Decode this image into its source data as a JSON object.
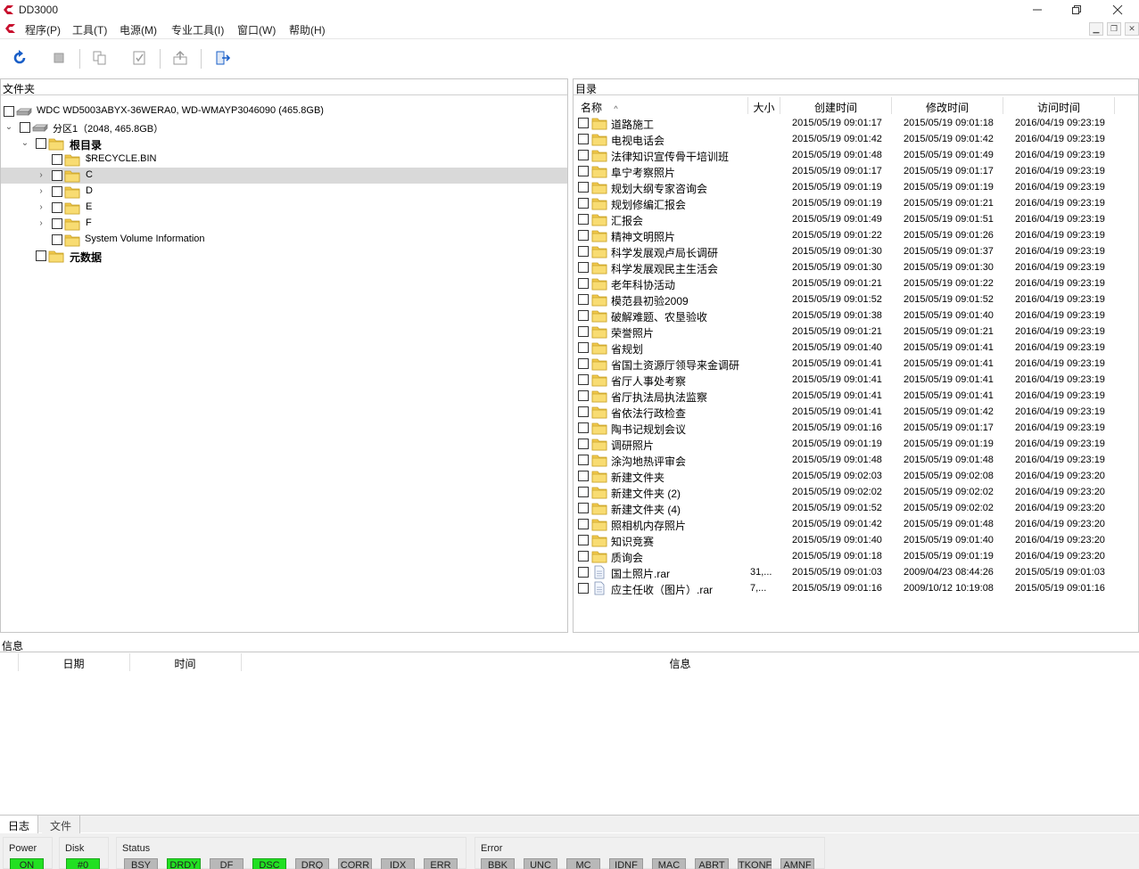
{
  "window": {
    "title": "DD3000"
  },
  "menu": {
    "items": [
      "程序(P)",
      "工具(T)",
      "电源(M)",
      "专业工具(I)",
      "窗口(W)",
      "帮助(H)"
    ]
  },
  "colors": {
    "accent": "#c8102e",
    "led_on": "#22e022",
    "led_off": "#b8b8b8",
    "selection": "#d9d9d9",
    "folder": "#f2c94c"
  },
  "folder_panel": {
    "title": "文件夹",
    "tree": [
      {
        "label": "WDC WD5003ABYX-36WERA0, WD-WMAYP3046090 (465.8GB)",
        "icon": "disk-icon"
      },
      {
        "label": "分区1（2048, 465.8GB）",
        "icon": "partition-icon"
      },
      {
        "label": "根目录",
        "icon": "folder-icon"
      },
      {
        "label": "$RECYCLE.BIN",
        "icon": "folder-icon"
      },
      {
        "label": "C",
        "icon": "folder-icon"
      },
      {
        "label": "D",
        "icon": "folder-icon"
      },
      {
        "label": "E",
        "icon": "folder-icon"
      },
      {
        "label": "F",
        "icon": "folder-icon"
      },
      {
        "label": "System Volume Information",
        "icon": "folder-icon"
      },
      {
        "label": "元数据",
        "icon": "folder-icon"
      }
    ]
  },
  "dir_panel": {
    "title": "目录",
    "columns": {
      "name": "名称",
      "size": "大小",
      "created": "创建时间",
      "modified": "修改时间",
      "accessed": "访问时间"
    },
    "rows": [
      {
        "name": "道路施工",
        "size": "",
        "created": "2015/05/19 09:01:17",
        "modified": "2015/05/19 09:01:18",
        "accessed": "2016/04/19 09:23:19",
        "type": "folder"
      },
      {
        "name": "电视电话会",
        "size": "",
        "created": "2015/05/19 09:01:42",
        "modified": "2015/05/19 09:01:42",
        "accessed": "2016/04/19 09:23:19",
        "type": "folder"
      },
      {
        "name": "法律知识宣传骨干培训班",
        "size": "",
        "created": "2015/05/19 09:01:48",
        "modified": "2015/05/19 09:01:49",
        "accessed": "2016/04/19 09:23:19",
        "type": "folder"
      },
      {
        "name": "阜宁考察照片",
        "size": "",
        "created": "2015/05/19 09:01:17",
        "modified": "2015/05/19 09:01:17",
        "accessed": "2016/04/19 09:23:19",
        "type": "folder"
      },
      {
        "name": "规划大纲专家咨询会",
        "size": "",
        "created": "2015/05/19 09:01:19",
        "modified": "2015/05/19 09:01:19",
        "accessed": "2016/04/19 09:23:19",
        "type": "folder"
      },
      {
        "name": "规划修编汇报会",
        "size": "",
        "created": "2015/05/19 09:01:19",
        "modified": "2015/05/19 09:01:21",
        "accessed": "2016/04/19 09:23:19",
        "type": "folder"
      },
      {
        "name": "汇报会",
        "size": "",
        "created": "2015/05/19 09:01:49",
        "modified": "2015/05/19 09:01:51",
        "accessed": "2016/04/19 09:23:19",
        "type": "folder"
      },
      {
        "name": "精神文明照片",
        "size": "",
        "created": "2015/05/19 09:01:22",
        "modified": "2015/05/19 09:01:26",
        "accessed": "2016/04/19 09:23:19",
        "type": "folder"
      },
      {
        "name": "科学发展观卢局长调研",
        "size": "",
        "created": "2015/05/19 09:01:30",
        "modified": "2015/05/19 09:01:37",
        "accessed": "2016/04/19 09:23:19",
        "type": "folder"
      },
      {
        "name": "科学发展观民主生活会",
        "size": "",
        "created": "2015/05/19 09:01:30",
        "modified": "2015/05/19 09:01:30",
        "accessed": "2016/04/19 09:23:19",
        "type": "folder"
      },
      {
        "name": "老年科协活动",
        "size": "",
        "created": "2015/05/19 09:01:21",
        "modified": "2015/05/19 09:01:22",
        "accessed": "2016/04/19 09:23:19",
        "type": "folder"
      },
      {
        "name": "模范县初验2009",
        "size": "",
        "created": "2015/05/19 09:01:52",
        "modified": "2015/05/19 09:01:52",
        "accessed": "2016/04/19 09:23:19",
        "type": "folder"
      },
      {
        "name": "破解难题、农垦验收",
        "size": "",
        "created": "2015/05/19 09:01:38",
        "modified": "2015/05/19 09:01:40",
        "accessed": "2016/04/19 09:23:19",
        "type": "folder"
      },
      {
        "name": "荣誉照片",
        "size": "",
        "created": "2015/05/19 09:01:21",
        "modified": "2015/05/19 09:01:21",
        "accessed": "2016/04/19 09:23:19",
        "type": "folder"
      },
      {
        "name": "省规划",
        "size": "",
        "created": "2015/05/19 09:01:40",
        "modified": "2015/05/19 09:01:41",
        "accessed": "2016/04/19 09:23:19",
        "type": "folder"
      },
      {
        "name": "省国土资源厅领导来金调研",
        "size": "",
        "created": "2015/05/19 09:01:41",
        "modified": "2015/05/19 09:01:41",
        "accessed": "2016/04/19 09:23:19",
        "type": "folder"
      },
      {
        "name": "省厅人事处考察",
        "size": "",
        "created": "2015/05/19 09:01:41",
        "modified": "2015/05/19 09:01:41",
        "accessed": "2016/04/19 09:23:19",
        "type": "folder"
      },
      {
        "name": "省厅执法局执法监察",
        "size": "",
        "created": "2015/05/19 09:01:41",
        "modified": "2015/05/19 09:01:41",
        "accessed": "2016/04/19 09:23:19",
        "type": "folder"
      },
      {
        "name": "省依法行政检查",
        "size": "",
        "created": "2015/05/19 09:01:41",
        "modified": "2015/05/19 09:01:42",
        "accessed": "2016/04/19 09:23:19",
        "type": "folder"
      },
      {
        "name": "陶书记规划会议",
        "size": "",
        "created": "2015/05/19 09:01:16",
        "modified": "2015/05/19 09:01:17",
        "accessed": "2016/04/19 09:23:19",
        "type": "folder"
      },
      {
        "name": "调研照片",
        "size": "",
        "created": "2015/05/19 09:01:19",
        "modified": "2015/05/19 09:01:19",
        "accessed": "2016/04/19 09:23:19",
        "type": "folder"
      },
      {
        "name": "涂沟地热评审会",
        "size": "",
        "created": "2015/05/19 09:01:48",
        "modified": "2015/05/19 09:01:48",
        "accessed": "2016/04/19 09:23:19",
        "type": "folder"
      },
      {
        "name": "新建文件夹",
        "size": "",
        "created": "2015/05/19 09:02:03",
        "modified": "2015/05/19 09:02:08",
        "accessed": "2016/04/19 09:23:20",
        "type": "folder"
      },
      {
        "name": "新建文件夹 (2)",
        "size": "",
        "created": "2015/05/19 09:02:02",
        "modified": "2015/05/19 09:02:02",
        "accessed": "2016/04/19 09:23:20",
        "type": "folder"
      },
      {
        "name": "新建文件夹 (4)",
        "size": "",
        "created": "2015/05/19 09:01:52",
        "modified": "2015/05/19 09:02:02",
        "accessed": "2016/04/19 09:23:20",
        "type": "folder"
      },
      {
        "name": "照相机内存照片",
        "size": "",
        "created": "2015/05/19 09:01:42",
        "modified": "2015/05/19 09:01:48",
        "accessed": "2016/04/19 09:23:20",
        "type": "folder"
      },
      {
        "name": "知识竞赛",
        "size": "",
        "created": "2015/05/19 09:01:40",
        "modified": "2015/05/19 09:01:40",
        "accessed": "2016/04/19 09:23:20",
        "type": "folder"
      },
      {
        "name": "质询会",
        "size": "",
        "created": "2015/05/19 09:01:18",
        "modified": "2015/05/19 09:01:19",
        "accessed": "2016/04/19 09:23:20",
        "type": "folder"
      },
      {
        "name": "国土照片.rar",
        "size": "31,...",
        "created": "2015/05/19 09:01:03",
        "modified": "2009/04/23 08:44:26",
        "accessed": "2015/05/19 09:01:03",
        "type": "file"
      },
      {
        "name": "应主任收（图片）.rar",
        "size": "7,...",
        "created": "2015/05/19 09:01:16",
        "modified": "2009/10/12 10:19:08",
        "accessed": "2015/05/19 09:01:16",
        "type": "file"
      }
    ]
  },
  "info_panel": {
    "title": "信息",
    "columns": {
      "date": "日期",
      "time": "时间",
      "info": "信息"
    }
  },
  "tabs": [
    "日志",
    "文件"
  ],
  "status": {
    "power": {
      "label": "Power",
      "leds": [
        {
          "text": "ON",
          "on": true
        }
      ]
    },
    "disk": {
      "label": "Disk",
      "leds": [
        {
          "text": "#0",
          "on": true
        }
      ]
    },
    "status": {
      "label": "Status",
      "leds": [
        {
          "text": "BSY",
          "on": false
        },
        {
          "text": "DRDY",
          "on": true
        },
        {
          "text": "DF",
          "on": false
        },
        {
          "text": "DSC",
          "on": true
        },
        {
          "text": "DRQ",
          "on": false
        },
        {
          "text": "CORR",
          "on": false
        },
        {
          "text": "IDX",
          "on": false
        },
        {
          "text": "ERR",
          "on": false
        }
      ]
    },
    "error": {
      "label": "Error",
      "leds": [
        {
          "text": "BBK",
          "on": false
        },
        {
          "text": "UNC",
          "on": false
        },
        {
          "text": "MC",
          "on": false
        },
        {
          "text": "IDNF",
          "on": false
        },
        {
          "text": "MAC",
          "on": false
        },
        {
          "text": "ABRT",
          "on": false
        },
        {
          "text": "TKONF",
          "on": false
        },
        {
          "text": "AMNF",
          "on": false
        }
      ]
    }
  }
}
